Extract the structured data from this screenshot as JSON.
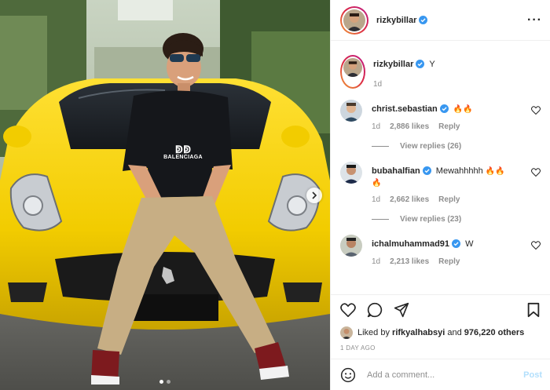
{
  "post": {
    "author": "rizkybillar",
    "caption": "Y",
    "caption_age": "1d",
    "comments": [
      {
        "username": "christ.sebastian",
        "verified": true,
        "text": "",
        "emojis": "🔥🔥",
        "age": "1d",
        "likes": "2,886 likes",
        "reply": "Reply",
        "view_replies": "View replies (26)"
      },
      {
        "username": "bubahalfian",
        "verified": true,
        "text": "Mewahhhhh",
        "emojis": "🔥🔥",
        "emojis2": "🔥",
        "age": "1d",
        "likes": "2,662 likes",
        "reply": "Reply",
        "view_replies": "View replies (23)"
      },
      {
        "username": "ichalmuhammad91",
        "verified": true,
        "text": "W",
        "age": "1d",
        "likes": "2,213 likes",
        "reply": "Reply"
      }
    ],
    "liked_by_prefix": "Liked by",
    "liked_by_user": "rifkyalhabsyi",
    "liked_by_and": "and",
    "liked_by_others": "976,220 others",
    "posted_time": "1 DAY AGO",
    "add_comment_placeholder": "Add a comment...",
    "post_label": "Post"
  },
  "photo": {
    "shirt_logo": "BALENCIAGA",
    "carousel_position": 1,
    "carousel_total": 2
  },
  "colors": {
    "verified": "#3897f0",
    "post_disabled": "#b2dffc",
    "car": "#f5d300",
    "muted": "#8e8e8e"
  },
  "icons": [
    "more-options-icon",
    "verified-icon",
    "heart-icon",
    "comment-icon",
    "share-icon",
    "bookmark-icon",
    "emoji-icon",
    "chevron-right-icon"
  ]
}
